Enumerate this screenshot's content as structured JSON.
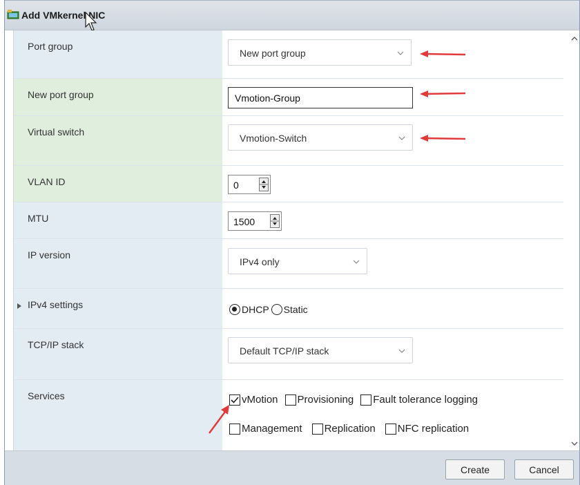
{
  "dialog": {
    "title": "Add VMkernel NIC",
    "icon": "network-adapter-icon"
  },
  "fields": {
    "port_group": {
      "label": "Port group",
      "value": "New port group"
    },
    "new_port_group": {
      "label": "New port group",
      "value": "Vmotion-Group"
    },
    "virtual_switch": {
      "label": "Virtual switch",
      "value": "Vmotion-Switch"
    },
    "vlan_id": {
      "label": "VLAN ID",
      "value": "0"
    },
    "mtu": {
      "label": "MTU",
      "value": "1500"
    },
    "ip_version": {
      "label": "IP version",
      "value": "IPv4 only"
    },
    "ipv4_settings": {
      "label": "IPv4 settings",
      "option_dhcp": "DHCP",
      "option_static": "Static",
      "selected": "DHCP"
    },
    "tcpip_stack": {
      "label": "TCP/IP stack",
      "value": "Default TCP/IP stack"
    },
    "services": {
      "label": "Services",
      "items": [
        {
          "label": "vMotion",
          "checked": true
        },
        {
          "label": "Provisioning",
          "checked": false
        },
        {
          "label": "Fault tolerance logging",
          "checked": false
        },
        {
          "label": "Management",
          "checked": false
        },
        {
          "label": "Replication",
          "checked": false
        },
        {
          "label": "NFC replication",
          "checked": false
        }
      ]
    }
  },
  "footer": {
    "create_label": "Create",
    "cancel_label": "Cancel"
  },
  "colors": {
    "annotation_arrow": "#e03a3a",
    "label_blue": "#e3ebf3",
    "label_green": "#dfeedd"
  }
}
